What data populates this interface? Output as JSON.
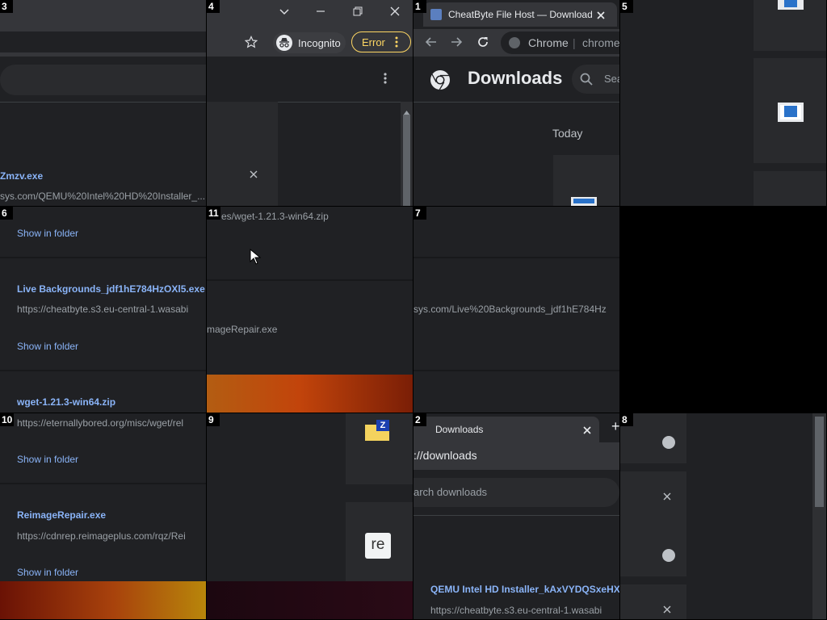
{
  "tiles": {
    "t1": "1",
    "t2": "2",
    "t3": "3",
    "t4": "4",
    "t5": "5",
    "t6": "6",
    "t7": "7",
    "t8": "8",
    "t9": "9",
    "t10": "10",
    "t11": "11"
  },
  "browser": {
    "tab_title": "CheatByte File Host — Download",
    "tab_downloads": "Downloads",
    "new_tab": "+",
    "incognito_label": "Incognito",
    "error_label": "Error",
    "omnibox_chrome": "Chrome",
    "omnibox_sep": "|",
    "omnibox_url_partial": "chrome",
    "url_downloads_partial": "://downloads"
  },
  "downloads": {
    "title": "Downloads",
    "search_placeholder": "Sea",
    "search_placeholder_partial": "arch downloads",
    "date_header": "Today",
    "show_in_folder": "Show in folder",
    "items": [
      {
        "name": "QEMU Intel HD Installer_kAxVYDQSxeHX",
        "url": "https://cheatbyte.s3.eu-central-1.wasabi",
        "name_partial": "Zmzv.exe",
        "url_partial": "sys.com/QEMU%20Intel%20HD%20Installer_..."
      },
      {
        "name": "Live Backgrounds_jdf1hE784HzOXl5.exe",
        "url": "https://cheatbyte.s3.eu-central-1.wasabi",
        "url_partial": "sys.com/Live%20Backgrounds_jdf1hE784Hz"
      },
      {
        "name": "wget-1.21.3-win64.zip",
        "url": "https://eternallybored.org/misc/wget/rel",
        "url_partial": "es/wget-1.21.3-win64.zip"
      },
      {
        "name": "ReimageRepair.exe",
        "url": "https://cdnrep.reimageplus.com/rqz/Rei",
        "name_partial": "mageRepair.exe"
      }
    ],
    "file_icon_re_text": "re",
    "file_icon_z_text": "Z"
  },
  "colors": {
    "background": "#202124",
    "link": "#8ab4f8",
    "error_accent": "#fdd663"
  }
}
